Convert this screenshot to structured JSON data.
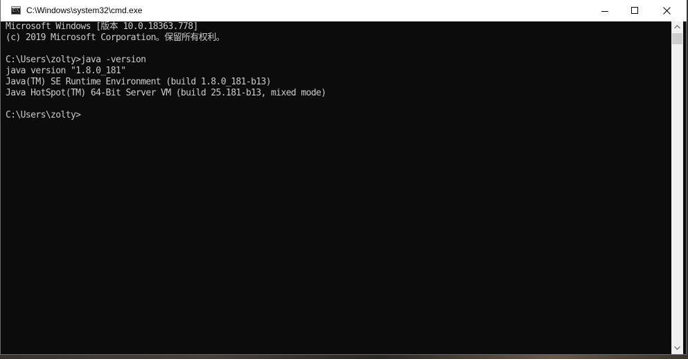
{
  "window": {
    "title": "C:\\Windows\\system32\\cmd.exe",
    "icon": "cmd-console-icon",
    "icon_text": "C:\\"
  },
  "controls": {
    "minimize_icon": "minimize-icon",
    "maximize_icon": "maximize-icon",
    "close_icon": "close-icon"
  },
  "console": {
    "lines": [
      "Microsoft Windows [版本 10.0.18363.778]",
      "(c) 2019 Microsoft Corporation。保留所有权利。",
      "",
      "C:\\Users\\zolty>java -version",
      "java version \"1.8.0_181\"",
      "Java(TM) SE Runtime Environment (build 1.8.0_181-b13)",
      "Java HotSpot(TM) 64-Bit Server VM (build 25.181-b13, mixed mode)",
      "",
      "C:\\Users\\zolty>"
    ],
    "colors": {
      "background": "#0c0c0c",
      "foreground": "#cccccc"
    }
  },
  "scrollbar": {
    "up_icon": "scroll-up-arrow-icon",
    "down_icon": "scroll-down-arrow-icon"
  }
}
